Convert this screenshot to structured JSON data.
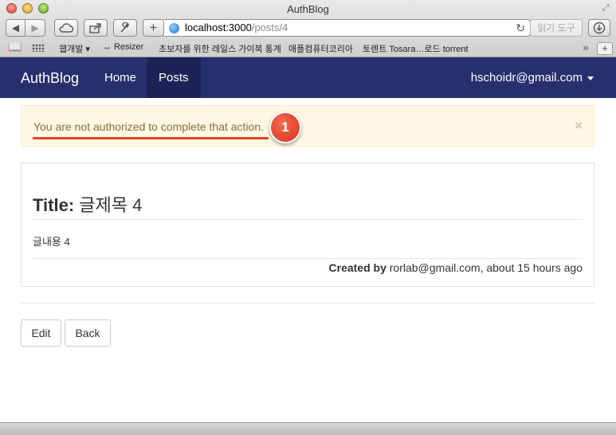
{
  "window": {
    "title": "AuthBlog"
  },
  "browser": {
    "url_host": "localhost:3000",
    "url_path": "/posts/4",
    "reader_label": "읽기 도구",
    "bookmarks": [
      "웹개발 ▾",
      "↔ Resizer",
      "초보자를 위한 레일스 가이북 통계",
      "애플컴퓨터코리아",
      "토렌트 Tosara…로드 torrent"
    ]
  },
  "navbar": {
    "brand": "AuthBlog",
    "links": [
      "Home",
      "Posts"
    ],
    "user_email": "hschoidr@gmail.com"
  },
  "alert": {
    "message": "You are not authorized to complete that action.",
    "close_glyph": "×",
    "badge_number": "1"
  },
  "post": {
    "title_label": "Title:",
    "title_value": "글제목 4",
    "body": "글내용 4",
    "created_by_label": "Created by",
    "created_by_rest": "rorlab@gmail.com, about 15 hours ago"
  },
  "actions": {
    "edit": "Edit",
    "back": "Back"
  },
  "colors": {
    "navbar": "#27306d",
    "navbar_active": "#1c2457",
    "alert_bg": "#fcf8e3",
    "alert_text": "#8a6d3b",
    "badge": "#d9331c",
    "underline": "#e8431f"
  },
  "icons": [
    "close-window-icon",
    "minimize-window-icon",
    "zoom-window-icon",
    "back-arrow-icon",
    "forward-arrow-icon",
    "icloud-tabs-icon",
    "share-icon",
    "wrench-icon",
    "new-tab-plus-icon",
    "globe-icon",
    "reload-icon",
    "download-icon",
    "bookmarks-book-icon",
    "top-sites-grid-icon",
    "more-bookmarks-icon",
    "add-tab-icon",
    "dropdown-caret-icon"
  ]
}
